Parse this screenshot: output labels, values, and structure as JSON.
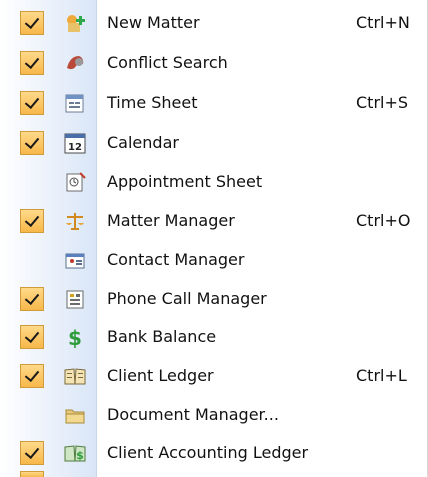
{
  "menu": {
    "items": [
      {
        "label": "New Matter",
        "shortcut": "Ctrl+N",
        "checked": true,
        "icon": "new-matter-icon"
      },
      {
        "label": "Conflict Search",
        "shortcut": "",
        "checked": true,
        "icon": "conflict-search-icon"
      },
      {
        "label": "Time Sheet",
        "shortcut": "Ctrl+S",
        "checked": true,
        "icon": "time-sheet-icon"
      },
      {
        "label": "Calendar",
        "shortcut": "",
        "checked": true,
        "icon": "calendar-icon",
        "icon_text": "12"
      },
      {
        "label": "Appointment Sheet",
        "shortcut": "",
        "checked": false,
        "icon": "appointment-sheet-icon"
      },
      {
        "label": "Matter Manager",
        "shortcut": "Ctrl+O",
        "checked": true,
        "icon": "matter-manager-icon"
      },
      {
        "label": "Contact Manager",
        "shortcut": "",
        "checked": false,
        "icon": "contact-manager-icon"
      },
      {
        "label": "Phone Call Manager",
        "shortcut": "",
        "checked": true,
        "icon": "phone-call-manager-icon"
      },
      {
        "label": "Bank Balance",
        "shortcut": "",
        "checked": true,
        "icon": "bank-balance-icon"
      },
      {
        "label": "Client Ledger",
        "shortcut": "Ctrl+L",
        "checked": true,
        "icon": "client-ledger-icon"
      },
      {
        "label": "Document Manager...",
        "shortcut": "",
        "checked": false,
        "icon": "document-manager-icon"
      },
      {
        "label": "Client Accounting Ledger",
        "shortcut": "",
        "checked": true,
        "icon": "client-accounting-ledger-icon"
      }
    ]
  },
  "colors": {
    "check_fill": "#f7b84a",
    "gutter": "#d9e6f7"
  }
}
